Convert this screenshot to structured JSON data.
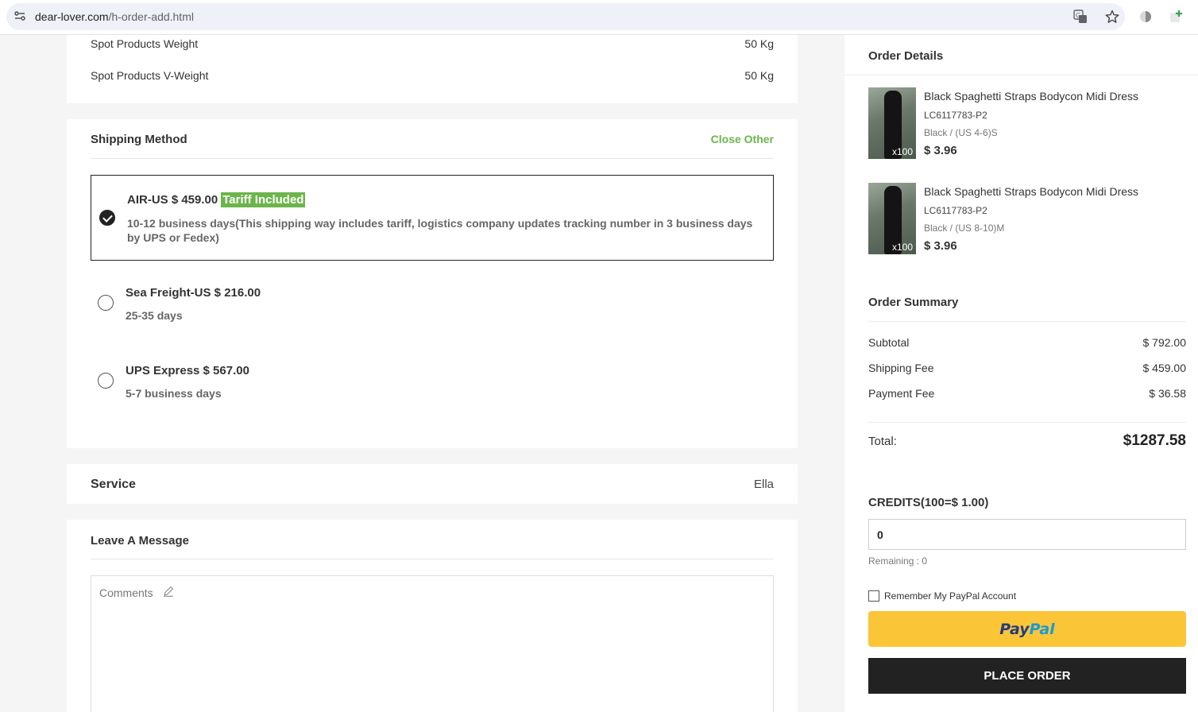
{
  "browser": {
    "url_host": "dear-lover.com",
    "url_path": "/h-order-add.html"
  },
  "weights": [
    {
      "label": "Spot Products Weight",
      "value": "50 Kg"
    },
    {
      "label": "Spot Products V-Weight",
      "value": "50 Kg"
    }
  ],
  "shipping": {
    "title": "Shipping Method",
    "close_other": "Close Other",
    "options": [
      {
        "name": "AIR-US $ 459.00",
        "badge": "Tariff Included",
        "desc": "10-12 business days(This shipping way includes tariff, logistics company updates tracking number in 3 business days by UPS or Fedex)",
        "selected": true
      },
      {
        "name": "Sea Freight-US $ 216.00",
        "desc": "25-35 days",
        "selected": false
      },
      {
        "name": "UPS Express $ 567.00",
        "desc": "5-7 business days",
        "selected": false
      }
    ]
  },
  "service": {
    "title": "Service",
    "value": "Ella"
  },
  "message": {
    "title": "Leave A Message",
    "comments_label": "Comments"
  },
  "order_details": {
    "title": "Order Details",
    "items": [
      {
        "name": "Black Spaghetti Straps Bodycon Midi Dress",
        "sku": "LC6117783-P2",
        "variant": "Black / (US 4-6)S",
        "price": "$ 3.96",
        "qty": "x100"
      },
      {
        "name": "Black Spaghetti Straps Bodycon Midi Dress",
        "sku": "LC6117783-P2",
        "variant": "Black / (US 8-10)M",
        "price": "$ 3.96",
        "qty": "x100"
      }
    ]
  },
  "order_summary": {
    "title": "Order Summary",
    "rows": [
      {
        "label": "Subtotal",
        "value": "$ 792.00"
      },
      {
        "label": "Shipping Fee",
        "value": "$ 459.00"
      },
      {
        "label": "Payment Fee",
        "value": "$ 36.58"
      }
    ],
    "total_label": "Total:",
    "total_value": "$1287.58"
  },
  "credits": {
    "label": "CREDITS(100=$ 1.00)",
    "value": "0",
    "remaining": "Remaining : 0"
  },
  "payment": {
    "remember_label": "Remember My PayPal Account",
    "paypal_part1": "Pay",
    "paypal_part2": "Pal",
    "place_order": "PLACE ORDER"
  },
  "colors": {
    "accent_green": "#6bb54a",
    "paypal_yellow": "#fbc538",
    "dark_button": "#222222"
  }
}
